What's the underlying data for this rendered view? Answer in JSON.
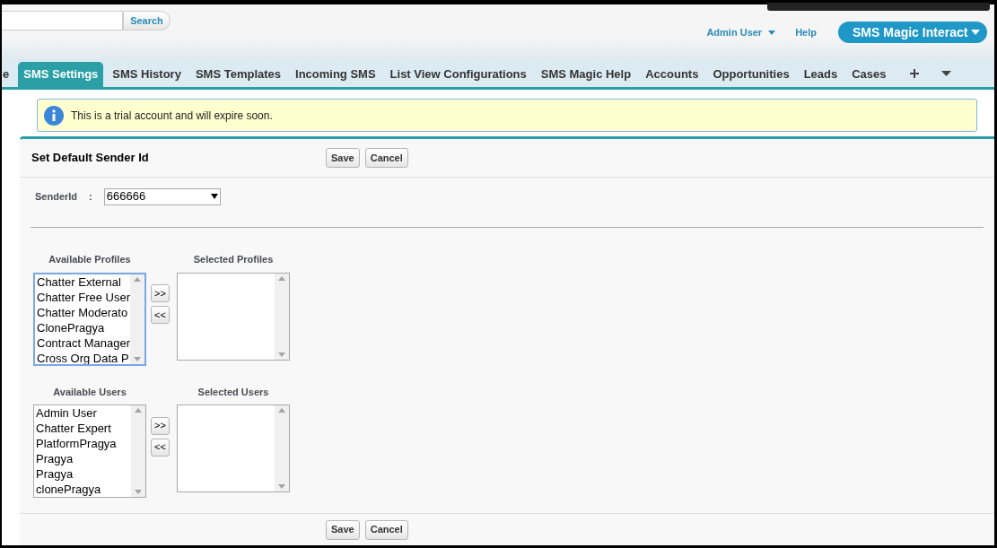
{
  "header": {
    "search_button": "Search",
    "user_menu": "Admin User",
    "help": "Help",
    "app_menu": "SMS Magic Interact"
  },
  "tabs": [
    {
      "label": "e",
      "selected": false
    },
    {
      "label": "SMS Settings",
      "selected": true
    },
    {
      "label": "SMS History",
      "selected": false
    },
    {
      "label": "SMS Templates",
      "selected": false
    },
    {
      "label": "Incoming SMS",
      "selected": false
    },
    {
      "label": "List View Configurations",
      "selected": false
    },
    {
      "label": "SMS Magic Help",
      "selected": false
    },
    {
      "label": "Accounts",
      "selected": false
    },
    {
      "label": "Opportunities",
      "selected": false
    },
    {
      "label": "Leads",
      "selected": false
    },
    {
      "label": "Cases",
      "selected": false
    }
  ],
  "message": "This is a trial account and will expire soon.",
  "panel": {
    "title": "Set Default Sender Id",
    "buttons": [
      "Save",
      "Cancel"
    ],
    "sender": {
      "label": "SenderId",
      "separator": ":",
      "value": "666666"
    },
    "pickers": [
      {
        "available": {
          "label": "Available Profiles",
          "focused": true,
          "items": [
            "Chatter External",
            "Chatter Free User",
            "Chatter Moderato",
            "ClonePragya",
            "Contract Manager",
            "Cross Org Data P"
          ]
        },
        "add": ">>",
        "remove": "<<",
        "selected": {
          "label": "Selected Profiles",
          "focused": false
        }
      },
      {
        "available": {
          "label": "Available Users",
          "focused": false,
          "items": [
            "Admin User",
            "Chatter Expert",
            "PlatformPragya",
            "Pragya",
            "Pragya",
            "clonePragya"
          ]
        },
        "add": ">>",
        "remove": "<<",
        "selected": {
          "label": "Selected Users",
          "focused": false
        }
      }
    ],
    "footer_buttons": [
      "Save",
      "Cancel"
    ]
  }
}
